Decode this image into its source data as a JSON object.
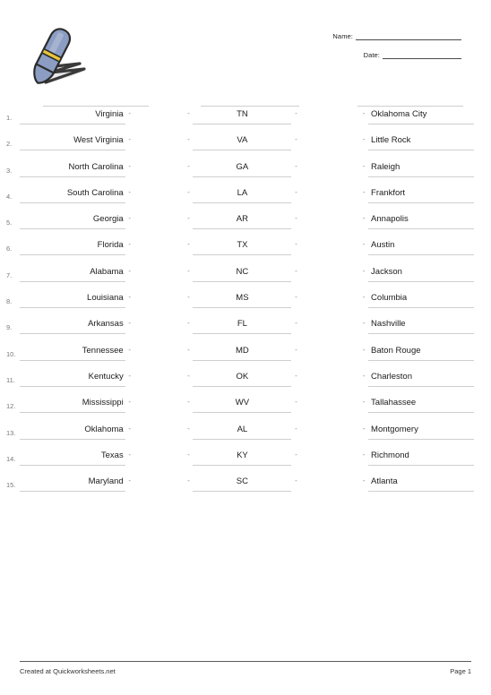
{
  "header": {
    "icon": "fountain-pen-icon",
    "name_label": "Name:",
    "name_value": "",
    "date_label": "Date:",
    "date_value": ""
  },
  "worksheet": {
    "rows": [
      {
        "num": "1.",
        "state": "Virginia",
        "abbr": "TN",
        "capital": "Oklahoma City"
      },
      {
        "num": "2.",
        "state": "West Virginia",
        "abbr": "VA",
        "capital": "Little Rock"
      },
      {
        "num": "3.",
        "state": "North Carolina",
        "abbr": "GA",
        "capital": "Raleigh"
      },
      {
        "num": "4.",
        "state": "South Carolina",
        "abbr": "LA",
        "capital": "Frankfort"
      },
      {
        "num": "5.",
        "state": "Georgia",
        "abbr": "AR",
        "capital": "Annapolis"
      },
      {
        "num": "6.",
        "state": "Florida",
        "abbr": "TX",
        "capital": "Austin"
      },
      {
        "num": "7.",
        "state": "Alabama",
        "abbr": "NC",
        "capital": "Jackson"
      },
      {
        "num": "8.",
        "state": "Louisiana",
        "abbr": "MS",
        "capital": "Columbia"
      },
      {
        "num": "9.",
        "state": "Arkansas",
        "abbr": "FL",
        "capital": "Nashville"
      },
      {
        "num": "10.",
        "state": "Tennessee",
        "abbr": "MD",
        "capital": "Baton Rouge"
      },
      {
        "num": "11.",
        "state": "Kentucky",
        "abbr": "OK",
        "capital": "Charleston"
      },
      {
        "num": "12.",
        "state": "Mississippi",
        "abbr": "WV",
        "capital": "Tallahassee"
      },
      {
        "num": "13.",
        "state": "Oklahoma",
        "abbr": "AL",
        "capital": "Montgomery"
      },
      {
        "num": "14.",
        "state": "Texas",
        "abbr": "KY",
        "capital": "Richmond"
      },
      {
        "num": "15.",
        "state": "Maryland",
        "abbr": "SC",
        "capital": "Atlanta"
      }
    ],
    "dash": "-"
  },
  "footer": {
    "credit": "Created at Quickworksheets.net",
    "page": "Page 1"
  },
  "colors": {
    "pen_body": "#8b9dc3",
    "pen_outline": "#2b2b2b",
    "pen_band": "#e8c53a",
    "rule": "#cfcfcf",
    "text": "#1c1c1c",
    "muted": "#777777"
  }
}
